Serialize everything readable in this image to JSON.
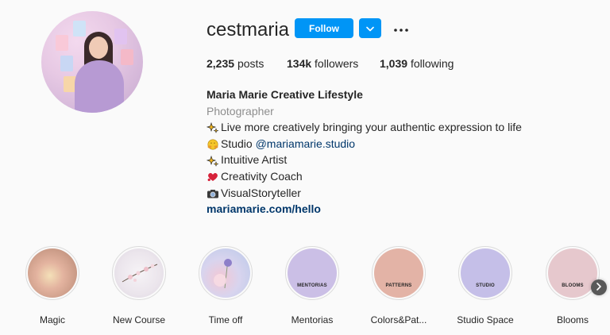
{
  "profile": {
    "username": "cestmaria",
    "follow_label": "Follow",
    "stats": {
      "posts_count": "2,235",
      "posts_label": "posts",
      "followers_count": "134k",
      "followers_label": "followers",
      "following_count": "1,039",
      "following_label": "following"
    },
    "bio": {
      "full_name": "Maria Marie Creative Lifestyle",
      "category": "Photographer",
      "lines": [
        {
          "emoji": "sparkles",
          "text": "Live more creatively bringing your authentic expression to life"
        },
        {
          "emoji": "hugging-face",
          "prefix": "Studio ",
          "mention": "@mariamarie.studio"
        },
        {
          "emoji": "sparkles",
          "text": "Intuitive Artist"
        },
        {
          "emoji": "heart-exclamation",
          "text": "Creativity Coach"
        },
        {
          "emoji": "camera",
          "text": "VisualStoryteller"
        }
      ],
      "website": "mariamarie.com/hello"
    }
  },
  "highlights": [
    {
      "label": "Magic",
      "cover_text": "",
      "color": "#d9a89a"
    },
    {
      "label": "New Course",
      "cover_text": "",
      "color": "#ede8ef"
    },
    {
      "label": "Time off",
      "cover_text": "",
      "color": "#c9d3ea"
    },
    {
      "label": "Mentorias",
      "cover_text": "MENTORIAS",
      "color": "#cbbfe6"
    },
    {
      "label": "Colors&Pat...",
      "cover_text": "PATTERNS",
      "color": "#e3b3a6"
    },
    {
      "label": "Studio Space",
      "cover_text": "STUDIO",
      "color": "#c5bfe8"
    },
    {
      "label": "Blooms",
      "cover_text": "BLOOMS",
      "color": "#e6c8cd"
    }
  ],
  "icons": {
    "dropdown": "chevron-down-icon",
    "more": "more-horizontal-icon",
    "next": "chevron-right-icon"
  },
  "colors": {
    "accent": "#0095f6",
    "link": "#00376b",
    "muted": "#8e8e8e"
  }
}
